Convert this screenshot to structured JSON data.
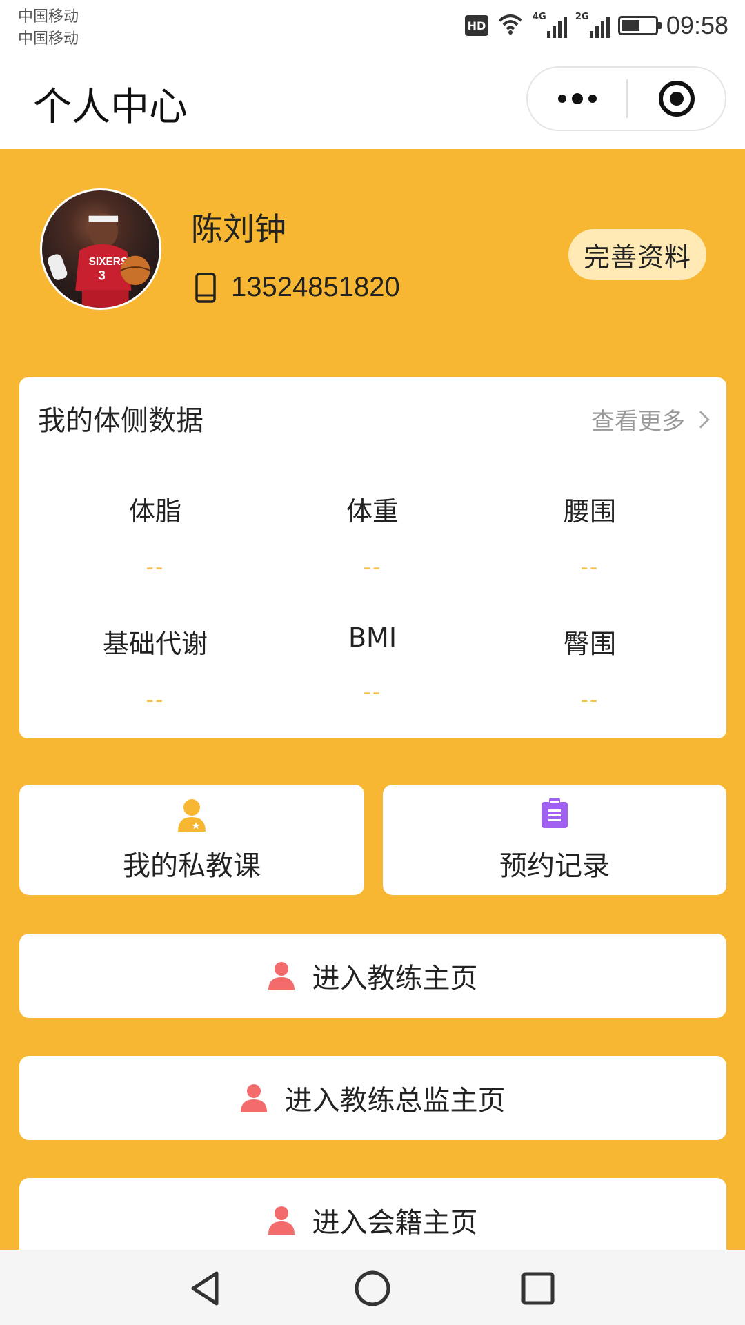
{
  "status_bar": {
    "carrier_1": "中国移动",
    "carrier_2": "中国移动",
    "hd": "HD",
    "signal_1_tag": "4G",
    "signal_2_tag": "2G",
    "time": "09:58",
    "battery_percent": 55
  },
  "title_bar": {
    "title": "个人中心",
    "more_icon": "more-dots-icon",
    "close_icon": "target-circle-icon"
  },
  "profile": {
    "name": "陈刘钟",
    "phone": "13524851820",
    "edit_label": "完善资料"
  },
  "body_data": {
    "title": "我的体侧数据",
    "more_label": "查看更多",
    "metrics": [
      {
        "label": "体脂",
        "value": "--"
      },
      {
        "label": "体重",
        "value": "--"
      },
      {
        "label": "腰围",
        "value": "--"
      },
      {
        "label": "基础代谢",
        "value": "--"
      },
      {
        "label": "BMI",
        "value": "--"
      },
      {
        "label": "臀围",
        "value": "--"
      }
    ]
  },
  "tiles": [
    {
      "label": "我的私教课",
      "icon": "user-icon",
      "color": "#F7B733"
    },
    {
      "label": "预约记录",
      "icon": "clipboard-icon",
      "color": "#A060F0"
    }
  ],
  "entries": [
    {
      "label": "进入教练主页",
      "icon": "person-icon"
    },
    {
      "label": "进入教练总监主页",
      "icon": "person-icon"
    },
    {
      "label": "进入会籍主页",
      "icon": "person-icon"
    }
  ],
  "colors": {
    "background": "#F7B733",
    "accent_pink": "#F46B6B",
    "metric_value": "#F2C14E"
  },
  "nav": {
    "back_icon": "back-triangle-icon",
    "home_icon": "home-circle-icon",
    "recent_icon": "recent-square-icon"
  }
}
